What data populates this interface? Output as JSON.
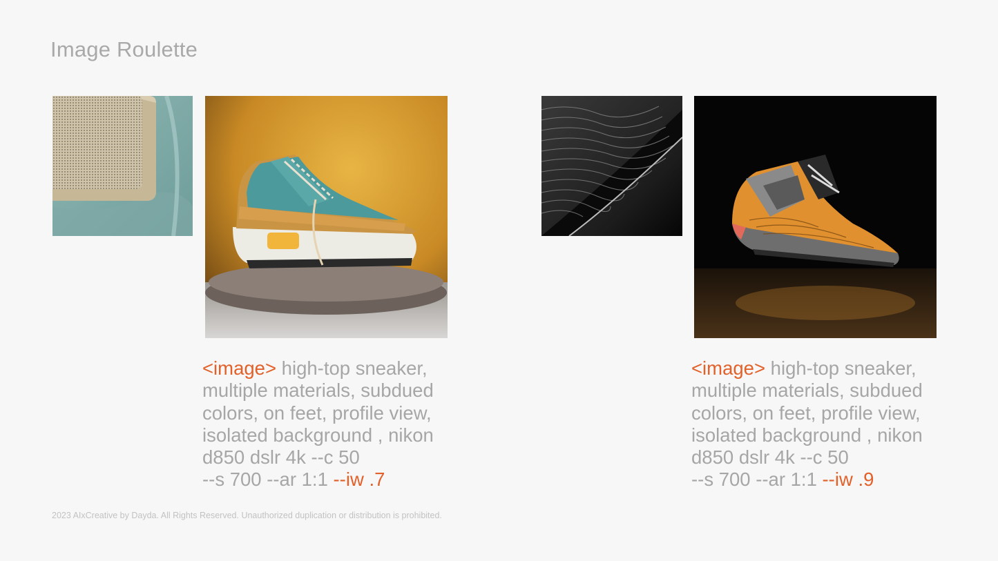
{
  "title": "Image Roulette",
  "accent_color": "#e2612a",
  "panels": [
    {
      "reference_image": "wood-speaker-mesh-on-teal-fabric",
      "result_image": "teal-suede-high-top-sneaker-on-wood-pedestal",
      "prompt": {
        "token": "<image>",
        "line1": " high-top sneaker,",
        "line2": "multiple materials, subdued",
        "line3": "colors, on feet, profile view,",
        "line4": "isolated background , nikon",
        "line5": "d850 dslr 4k --c 50",
        "line6": "--s 700 --ar 1:1 ",
        "iw": "--iw .7"
      }
    },
    {
      "reference_image": "black-rippled-surface-texture",
      "result_image": "orange-grey-textured-sneaker-on-black",
      "prompt": {
        "token": "<image>",
        "line1": " high-top sneaker,",
        "line2": "multiple materials, subdued",
        "line3": "colors, on feet, profile view,",
        "line4": "isolated background , nikon",
        "line5": "d850 dslr 4k --c 50",
        "line6": "--s 700 --ar 1:1 ",
        "iw": "--iw .9"
      }
    }
  ],
  "footer": "2023 AIxCreative by Dayda. All Rights Reserved. Unauthorized duplication or distribution is prohibited."
}
